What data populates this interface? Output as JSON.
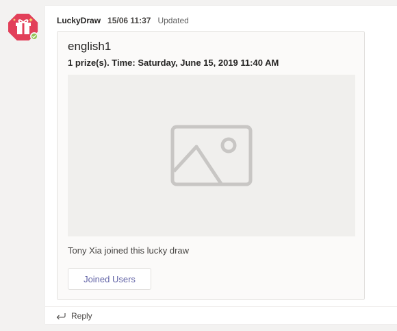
{
  "message": {
    "sender": "LuckyDraw",
    "timestamp": "15/06 11:37",
    "status": "Updated"
  },
  "card": {
    "title": "english1",
    "subtitle": "1 prize(s). Time: Saturday, June 15, 2019 11:40 AM",
    "joined_text": "Tony Xia joined this lucky draw",
    "joined_button_label": "Joined Users"
  },
  "reply": {
    "label": "Reply"
  },
  "icons": {
    "avatar": "gift-icon",
    "presence": "available-check-icon",
    "image": "image-placeholder-icon",
    "reply": "reply-arrow-icon"
  },
  "colors": {
    "avatar_red": "#e2405a",
    "presence_green": "#92c353",
    "accent": "#6264a7"
  }
}
